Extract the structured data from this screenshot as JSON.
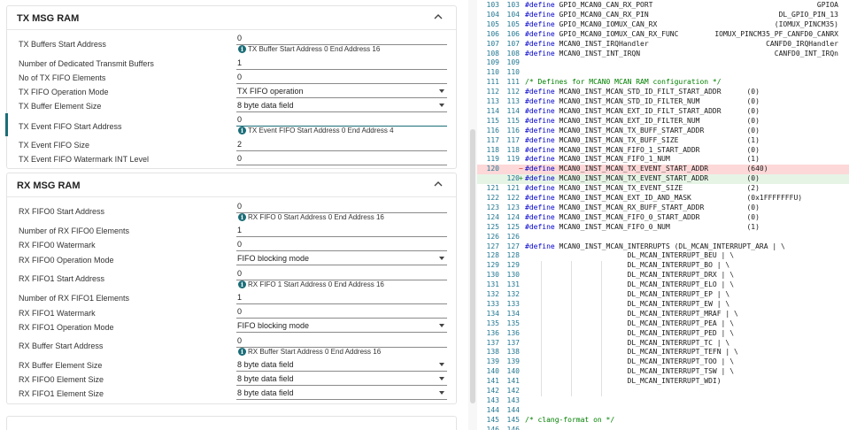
{
  "tx_section": {
    "title": "TX MSG RAM",
    "rows": [
      {
        "label": "TX Buffers Start Address",
        "value": "0",
        "hint": "TX Buffer Start Address 0 End Address 16"
      },
      {
        "label": "Number of Dedicated Transmit Buffers",
        "value": "1"
      },
      {
        "label": "No of TX FIFO Elements",
        "value": "0"
      },
      {
        "label": "TX FIFO Operation Mode",
        "value": "TX FIFO operation"
      },
      {
        "label": "TX Buffer Element Size",
        "value": "8 byte data field"
      },
      {
        "label": "TX Event FIFO Start Address",
        "value": "0",
        "hint": "TX Event FIFO Start Address 0 End Address 4"
      },
      {
        "label": "TX Event FIFO Size",
        "value": "2"
      },
      {
        "label": "TX Event FIFO Watermark INT Level",
        "value": "0"
      }
    ]
  },
  "rx_section": {
    "title": "RX MSG RAM",
    "rows": [
      {
        "label": "RX FIFO0 Start Address",
        "value": "0",
        "hint": "RX FIFO 0 Start Address 0 End Address 16"
      },
      {
        "label": "Number of RX FIFO0 Elements",
        "value": "1"
      },
      {
        "label": "RX FIFO0 Watermark",
        "value": "0"
      },
      {
        "label": "RX FIFO0 Operation Mode",
        "value": "FIFO blocking mode"
      },
      {
        "label": "RX FIFO1 Start Address",
        "value": "0",
        "hint": "RX FIFO 1 Start Address 0 End Address 16"
      },
      {
        "label": "Number of RX FIFO1 Elements",
        "value": "1"
      },
      {
        "label": "RX FIFO1 Watermark",
        "value": "0"
      },
      {
        "label": "RX FIFO1 Operation Mode",
        "value": "FIFO blocking mode"
      },
      {
        "label": "RX Buffer Start Address",
        "value": "0",
        "hint": "RX Buffer Start Address 0 End Address 16"
      },
      {
        "label": "RX Buffer Element Size",
        "value": "8 byte data field"
      },
      {
        "label": "RX FIFO0 Element Size",
        "value": "8 byte data field"
      },
      {
        "label": "RX FIFO1 Element Size",
        "value": "8 byte data field"
      }
    ]
  },
  "code": [
    {
      "l": "103",
      "r": "103",
      "t": "#define GPIO_MCAN0_CAN_RX_PORT",
      "rt": "GPIOA"
    },
    {
      "l": "104",
      "r": "104",
      "t": "#define GPIO_MCAN0_CAN_RX_PIN",
      "rt": "DL_GPIO_PIN_13"
    },
    {
      "l": "105",
      "r": "105",
      "t": "#define GPIO_MCAN0_IOMUX_CAN_RX",
      "rt": "(IOMUX_PINCM35)"
    },
    {
      "l": "106",
      "r": "106",
      "t": "#define GPIO_MCAN0_IOMUX_CAN_RX_FUNC",
      "rt": "IOMUX_PINCM35_PF_CANFD0_CANRX"
    },
    {
      "l": "107",
      "r": "107",
      "t": "#define MCAN0_INST_IRQHandler",
      "rt": "CANFD0_IRQHandler"
    },
    {
      "l": "108",
      "r": "108",
      "t": "#define MCAN0_INST_INT_IRQN",
      "rt": "CANFD0_INT_IRQn"
    },
    {
      "l": "109",
      "r": "109",
      "t": ""
    },
    {
      "l": "110",
      "r": "110",
      "t": ""
    },
    {
      "l": "111",
      "r": "111",
      "t": "/* Defines for MCAN0 MCAN RAM configuration */",
      "cm": true
    },
    {
      "l": "112",
      "r": "112",
      "t": "#define MCAN0_INST_MCAN_STD_ID_FILT_START_ADDR      (0)"
    },
    {
      "l": "113",
      "r": "113",
      "t": "#define MCAN0_INST_MCAN_STD_ID_FILTER_NUM           (0)"
    },
    {
      "l": "114",
      "r": "114",
      "t": "#define MCAN0_INST_MCAN_EXT_ID_FILT_START_ADDR      (0)"
    },
    {
      "l": "115",
      "r": "115",
      "t": "#define MCAN0_INST_MCAN_EXT_ID_FILTER_NUM           (0)"
    },
    {
      "l": "116",
      "r": "116",
      "t": "#define MCAN0_INST_MCAN_TX_BUFF_START_ADDR          (0)"
    },
    {
      "l": "117",
      "r": "117",
      "t": "#define MCAN0_INST_MCAN_TX_BUFF_SIZE                (1)"
    },
    {
      "l": "118",
      "r": "118",
      "t": "#define MCAN0_INST_MCAN_FIFO_1_START_ADDR           (0)"
    },
    {
      "l": "119",
      "r": "119",
      "t": "#define MCAN0_INST_MCAN_FIFO_1_NUM                  (1)"
    },
    {
      "l": "120",
      "r": "",
      "t": "#define MCAN0_INST_MCAN_TX_EVENT_START_ADDR         (640)",
      "type": "del",
      "mk": "−"
    },
    {
      "l": "",
      "r": "120",
      "t": "#define MCAN0_INST_MCAN_TX_EVENT_START_ADDR         (0)",
      "type": "add",
      "mk": "+"
    },
    {
      "l": "121",
      "r": "121",
      "t": "#define MCAN0_INST_MCAN_TX_EVENT_SIZE               (2)"
    },
    {
      "l": "122",
      "r": "122",
      "t": "#define MCAN0_INST_MCAN_EXT_ID_AND_MASK             (0x1FFFFFFFU)"
    },
    {
      "l": "123",
      "r": "123",
      "t": "#define MCAN0_INST_MCAN_RX_BUFF_START_ADDR          (0)"
    },
    {
      "l": "124",
      "r": "124",
      "t": "#define MCAN0_INST_MCAN_FIFO_0_START_ADDR           (0)"
    },
    {
      "l": "125",
      "r": "125",
      "t": "#define MCAN0_INST_MCAN_FIFO_0_NUM                  (1)"
    },
    {
      "l": "126",
      "r": "126",
      "t": ""
    },
    {
      "l": "127",
      "r": "127",
      "t": "#define MCAN0_INST_MCAN_INTERRUPTS (DL_MCAN_INTERRUPT_ARA | \\"
    },
    {
      "l": "128",
      "r": "128",
      "t": "                        DL_MCAN_INTERRUPT_BEU | \\"
    },
    {
      "l": "129",
      "r": "129",
      "t": "                        DL_MCAN_INTERRUPT_BO | \\"
    },
    {
      "l": "130",
      "r": "130",
      "t": "                        DL_MCAN_INTERRUPT_DRX | \\"
    },
    {
      "l": "131",
      "r": "131",
      "t": "                        DL_MCAN_INTERRUPT_ELO | \\"
    },
    {
      "l": "132",
      "r": "132",
      "t": "                        DL_MCAN_INTERRUPT_EP | \\"
    },
    {
      "l": "133",
      "r": "133",
      "t": "                        DL_MCAN_INTERRUPT_EW | \\"
    },
    {
      "l": "134",
      "r": "134",
      "t": "                        DL_MCAN_INTERRUPT_MRAF | \\"
    },
    {
      "l": "135",
      "r": "135",
      "t": "                        DL_MCAN_INTERRUPT_PEA | \\"
    },
    {
      "l": "136",
      "r": "136",
      "t": "                        DL_MCAN_INTERRUPT_PED | \\"
    },
    {
      "l": "137",
      "r": "137",
      "t": "                        DL_MCAN_INTERRUPT_TC | \\"
    },
    {
      "l": "138",
      "r": "138",
      "t": "                        DL_MCAN_INTERRUPT_TEFN | \\"
    },
    {
      "l": "139",
      "r": "139",
      "t": "                        DL_MCAN_INTERRUPT_TOO | \\"
    },
    {
      "l": "140",
      "r": "140",
      "t": "                        DL_MCAN_INTERRUPT_TSW | \\"
    },
    {
      "l": "141",
      "r": "141",
      "t": "                        DL_MCAN_INTERRUPT_WDI)"
    },
    {
      "l": "142",
      "r": "142",
      "t": ""
    },
    {
      "l": "143",
      "r": "143",
      "t": ""
    },
    {
      "l": "144",
      "r": "144",
      "t": ""
    },
    {
      "l": "145",
      "r": "145",
      "t": "/* clang-format on */",
      "cm": true
    },
    {
      "l": "146",
      "r": "146",
      "t": ""
    }
  ],
  "colors": {
    "accent": "#1a6d78",
    "deleted_line": "#fdd8d8",
    "added_line": "#e6f4e6"
  },
  "icons": {
    "info": "info-icon",
    "collapse": "chevron-up-icon",
    "dropdown": "dropdown-arrow-icon"
  }
}
